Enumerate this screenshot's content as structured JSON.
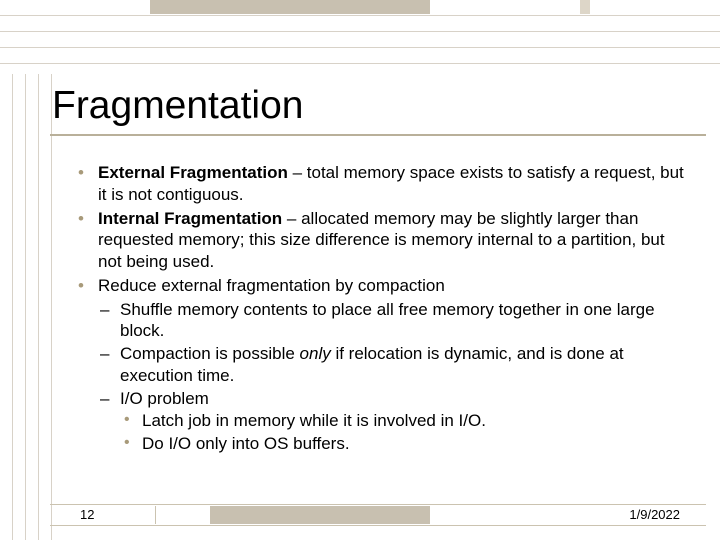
{
  "slide": {
    "title": "Fragmentation",
    "bullets": [
      {
        "level": 1,
        "parts": [
          {
            "text": "External Fragmentation",
            "bold": true
          },
          {
            "text": " – total memory space exists to satisfy a request, but it is not contiguous."
          }
        ]
      },
      {
        "level": 1,
        "parts": [
          {
            "text": "Internal Fragmentation",
            "bold": true
          },
          {
            "text": " – allocated memory may be slightly larger than requested memory; this size difference is memory internal to a partition, but not being used."
          }
        ]
      },
      {
        "level": 1,
        "parts": [
          {
            "text": "Reduce external fragmentation by compaction"
          }
        ]
      },
      {
        "level": 2,
        "parts": [
          {
            "text": "Shuffle memory contents to place all free memory together in one large block."
          }
        ]
      },
      {
        "level": 2,
        "parts": [
          {
            "text": "Compaction is possible "
          },
          {
            "text": "only",
            "italic": true
          },
          {
            "text": " if relocation is dynamic, and is done at execution time."
          }
        ]
      },
      {
        "level": 2,
        "parts": [
          {
            "text": "I/O problem"
          }
        ]
      },
      {
        "level": 3,
        "parts": [
          {
            "text": "Latch job in memory while it is involved in I/O."
          }
        ]
      },
      {
        "level": 3,
        "parts": [
          {
            "text": "Do I/O only into OS buffers."
          }
        ]
      }
    ],
    "footer": {
      "page": "12",
      "date": "1/9/2022"
    }
  }
}
